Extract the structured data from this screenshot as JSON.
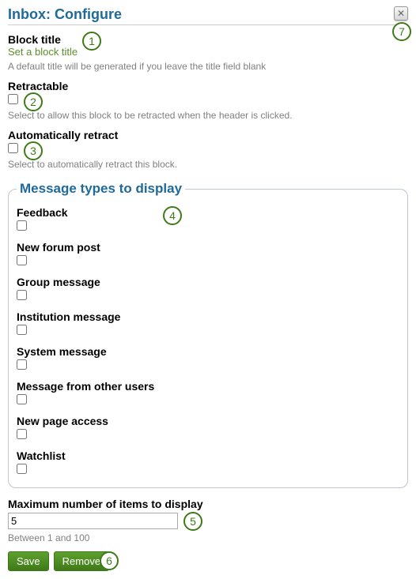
{
  "header": {
    "title": "Inbox: Configure"
  },
  "block_title": {
    "label": "Block title",
    "link": "Set a block title",
    "help": "A default title will be generated if you leave the title field blank"
  },
  "retractable": {
    "label": "Retractable",
    "help": "Select to allow this block to be retracted when the header is clicked."
  },
  "auto_retract": {
    "label": "Automatically retract",
    "help": "Select to automatically retract this block."
  },
  "message_types": {
    "legend": "Message types to display",
    "items": [
      {
        "label": "Feedback"
      },
      {
        "label": "New forum post"
      },
      {
        "label": "Group message"
      },
      {
        "label": "Institution message"
      },
      {
        "label": "System message"
      },
      {
        "label": "Message from other users"
      },
      {
        "label": "New page access"
      },
      {
        "label": "Watchlist"
      }
    ]
  },
  "max_items": {
    "label": "Maximum number of items to display",
    "value": "5",
    "help": "Between 1 and 100"
  },
  "buttons": {
    "save": "Save",
    "remove": "Remove"
  },
  "annotations": {
    "a1": "1",
    "a2": "2",
    "a3": "3",
    "a4": "4",
    "a5": "5",
    "a6": "6",
    "a7": "7"
  }
}
